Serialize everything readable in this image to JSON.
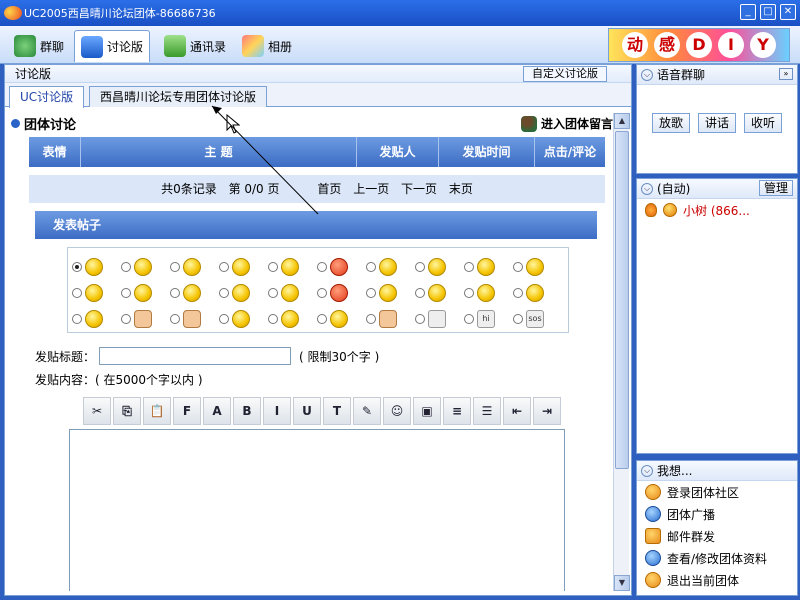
{
  "window": {
    "title": "UC2005西昌晴川论坛团体-86686736",
    "controls": [
      "_",
      "□",
      "✕"
    ]
  },
  "main_tabs": [
    {
      "label": "群聊",
      "icon": "group-chat-icon"
    },
    {
      "label": "讨论版",
      "icon": "discussion-board-icon",
      "active": true
    },
    {
      "label": "通讯录",
      "icon": "address-book-icon"
    },
    {
      "label": "相册",
      "icon": "photo-album-icon"
    }
  ],
  "banner": {
    "chars": [
      "动",
      "感",
      "D",
      "I",
      "Y"
    ]
  },
  "left": {
    "header": "讨论版",
    "custom_button": "自定义讨论版",
    "subtabs": [
      "UC讨论版",
      "西昌晴川论坛专用团体讨论版"
    ],
    "section_title": "团体讨论",
    "enter_msg": "进入团体留言",
    "table_headers": [
      "表情",
      "主  题",
      "发贴人",
      "发贴时间",
      "点击/评论"
    ],
    "pager": {
      "records": "共0条记录",
      "page": "第 0/0 页",
      "first": "首页",
      "prev": "上一页",
      "next": "下一页",
      "last": "末页"
    },
    "post_title": "发表帖子",
    "subject_label": "发贴标题：",
    "subject_value": "",
    "subject_limit": "( 限制30个字 )",
    "content_label": "发贴内容：( 在5000个字以内 )",
    "emoticons": [
      {
        "icon": "smile-icon",
        "text": "",
        "selected": true
      },
      {
        "icon": "smirk-icon",
        "text": ""
      },
      {
        "icon": "grin-icon",
        "text": ""
      },
      {
        "icon": "laugh-icon",
        "text": ""
      },
      {
        "icon": "shocked-icon",
        "text": ""
      },
      {
        "icon": "angry-icon",
        "text": "",
        "red": true
      },
      {
        "icon": "tongue-icon",
        "text": ""
      },
      {
        "icon": "cover-mouth-icon",
        "text": ""
      },
      {
        "icon": "cheer-icon",
        "text": ""
      },
      {
        "icon": "question-icon",
        "text": ""
      },
      {
        "icon": "happy-icon",
        "text": ""
      },
      {
        "icon": "love-eyes-icon",
        "text": ""
      },
      {
        "icon": "sleepy-icon",
        "text": ""
      },
      {
        "icon": "surprised-icon",
        "text": ""
      },
      {
        "icon": "blank-face-icon",
        "text": ""
      },
      {
        "icon": "shout-icon",
        "text": "",
        "red": true
      },
      {
        "icon": "dizzy-icon",
        "text": ""
      },
      {
        "icon": "spiral-icon",
        "text": ""
      },
      {
        "icon": "sad-icon",
        "text": ""
      },
      {
        "icon": "cool-icon",
        "text": ""
      },
      {
        "icon": "big-smile-icon",
        "text": ""
      },
      {
        "icon": "handshake-icon",
        "text": "",
        "hand": true
      },
      {
        "icon": "wave-icon",
        "text": "",
        "hand": true
      },
      {
        "icon": "thinking-icon",
        "text": ""
      },
      {
        "icon": "tired-icon",
        "text": ""
      },
      {
        "icon": "wink-icon",
        "text": ""
      },
      {
        "icon": "thumbs-up-icon",
        "text": "",
        "hand": true
      },
      {
        "icon": "speaker-icon",
        "text": "",
        "gray": true
      },
      {
        "icon": "hi-bubble-icon",
        "text": "hi",
        "gray": true
      },
      {
        "icon": "sos-bubble-icon",
        "text": "sos",
        "gray": true
      }
    ],
    "toolbar": [
      {
        "name": "cut-icon",
        "glyph": "✂"
      },
      {
        "name": "copy-icon",
        "glyph": "⎘"
      },
      {
        "name": "paste-icon",
        "glyph": "📋"
      },
      {
        "name": "font-icon",
        "glyph": "F"
      },
      {
        "name": "font-size-icon",
        "glyph": "A"
      },
      {
        "name": "bold-icon",
        "glyph": "B"
      },
      {
        "name": "italic-icon",
        "glyph": "I"
      },
      {
        "name": "underline-icon",
        "glyph": "U"
      },
      {
        "name": "text-color-icon",
        "glyph": "T"
      },
      {
        "name": "highlight-icon",
        "glyph": "✎"
      },
      {
        "name": "emoticon-icon",
        "glyph": "☺"
      },
      {
        "name": "insert-image-icon",
        "glyph": "▣"
      },
      {
        "name": "align-icon",
        "glyph": "≡"
      },
      {
        "name": "list-icon",
        "glyph": "☰"
      },
      {
        "name": "outdent-icon",
        "glyph": "⇤"
      },
      {
        "name": "indent-icon",
        "glyph": "⇥"
      }
    ]
  },
  "right": {
    "voice": {
      "title": "语音群聊",
      "buttons": [
        "放歌",
        "讲话",
        "收听"
      ]
    },
    "members": {
      "title": "(自动)",
      "manage": "管理",
      "users": [
        "小树 (866..."
      ]
    },
    "wish": {
      "title": "我想...",
      "items": [
        "登录团体社区",
        "团体广播",
        "邮件群发",
        "查看/修改团体资料",
        "退出当前团体"
      ]
    }
  }
}
